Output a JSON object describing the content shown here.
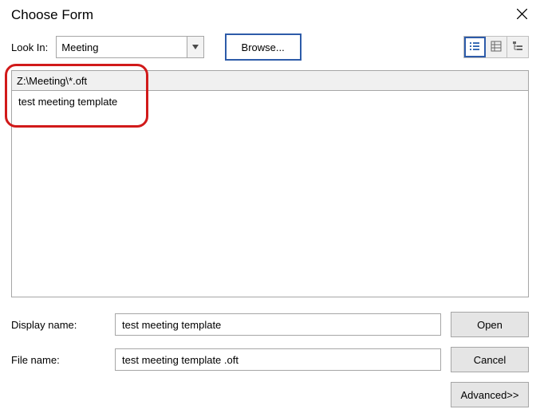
{
  "title": "Choose Form",
  "lookin_label": "Look In:",
  "lookin_value": "Meeting",
  "browse_label": "Browse...",
  "path": "Z:\\Meeting\\*.oft",
  "files": [
    {
      "name": "test meeting template"
    }
  ],
  "display_name_label": "Display name:",
  "display_name_value": "test meeting template",
  "file_name_label": "File name:",
  "file_name_value": "test meeting template .oft",
  "open_label": "Open",
  "cancel_label": "Cancel",
  "advanced_label": "Advanced>>",
  "view_buttons": {
    "list": "list-view-icon",
    "details": "details-view-icon",
    "tree": "tree-view-icon"
  }
}
